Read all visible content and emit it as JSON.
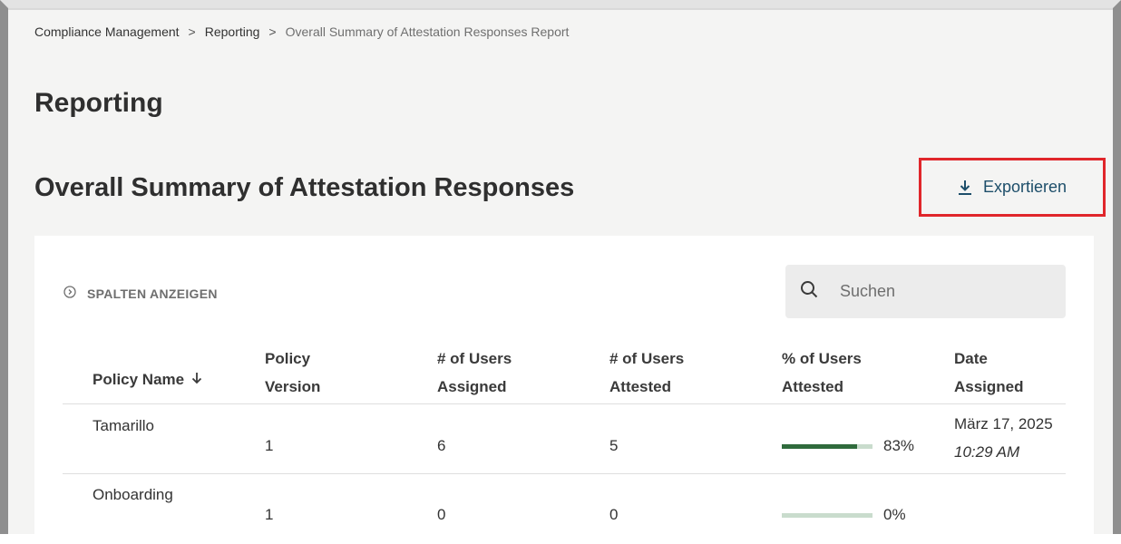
{
  "breadcrumb": {
    "items": [
      "Compliance Management",
      "Reporting",
      "Overall Summary of Attestation Responses Report"
    ],
    "separator": ">"
  },
  "page_title": "Reporting",
  "section_title": "Overall Summary of Attestation Responses",
  "export": {
    "label": "Exportieren",
    "icon": "download-icon"
  },
  "table_controls": {
    "show_columns_label": "SPALTEN ANZEIGEN",
    "search_placeholder": "Suchen",
    "search_value": ""
  },
  "table": {
    "headers": {
      "policy_name": "Policy Name",
      "policy_version": [
        "Policy",
        "Version"
      ],
      "users_assigned": [
        "# of Users",
        "Assigned"
      ],
      "users_attested": [
        "# of Users",
        "Attested"
      ],
      "pct_attested": [
        "% of Users",
        "Attested"
      ],
      "date_assigned": [
        "Date",
        "Assigned"
      ]
    },
    "sort": {
      "column": "policy_name",
      "direction": "descending"
    },
    "rows": [
      {
        "policy_name": "Tamarillo",
        "policy_version": "1",
        "users_assigned": "6",
        "users_attested": "5",
        "pct_attested_label": "83%",
        "pct_attested_value": 0.83,
        "date": "März 17, 2025",
        "time": "10:29 AM"
      },
      {
        "policy_name": "Onboarding",
        "policy_version": "1",
        "users_assigned": "0",
        "users_attested": "0",
        "pct_attested_label": "0%",
        "pct_attested_value": 0.0,
        "date": "",
        "time": ""
      }
    ]
  },
  "colors": {
    "accent_text": "#1d4e6a",
    "highlight_border": "#e0262b",
    "progress_fill": "#2f6b3c",
    "progress_track": "#c9dccd"
  }
}
